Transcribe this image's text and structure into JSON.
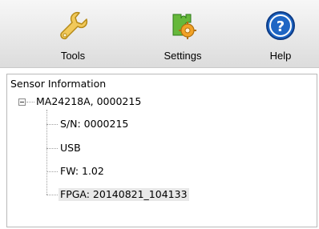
{
  "toolbar": {
    "tools_label": "Tools",
    "settings_label": "Settings",
    "help_label": "Help",
    "icons": [
      "wrench-icon",
      "puzzle-gear-icon",
      "question-circle-icon"
    ],
    "help_color": "#1f66c4"
  },
  "tree": {
    "root_label": "Sensor Information",
    "device_label": "MA24218A, 0000215",
    "children": [
      {
        "label": "S/N: 0000215"
      },
      {
        "label": "USB"
      },
      {
        "label": "FW: 1.02"
      },
      {
        "label": "FPGA: 20140821_104133"
      }
    ]
  }
}
